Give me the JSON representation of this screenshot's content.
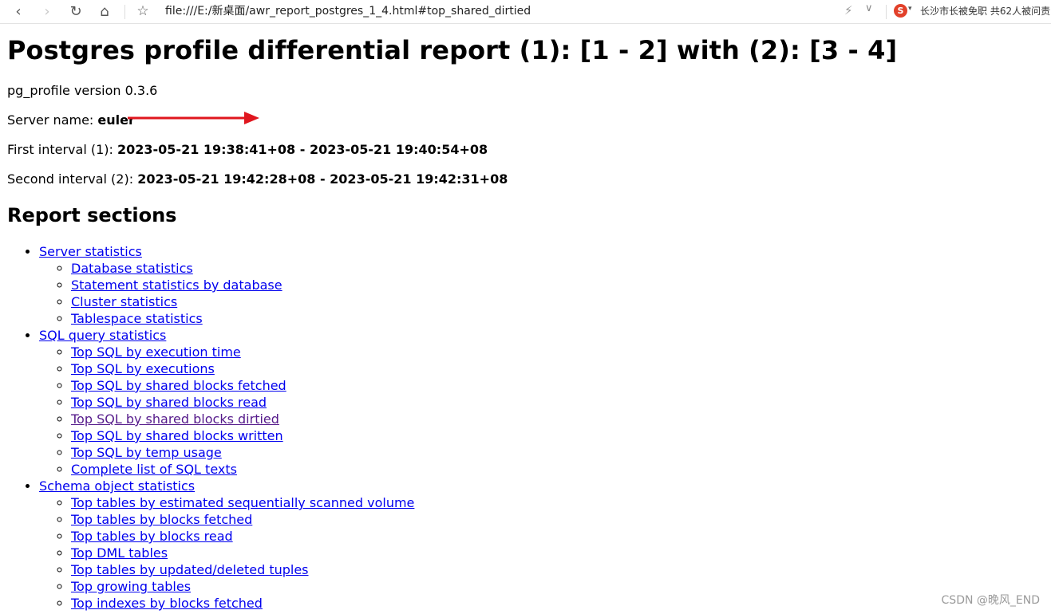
{
  "browser": {
    "address": "file:///E:/新桌面/awr_report_postgres_1_4.html#top_shared_dirtied",
    "news_ticker": "长沙市长被免职 共62人被问责",
    "sogou_label": "S"
  },
  "report": {
    "title": "Postgres profile differential report (1): [1 - 2] with (2): [3 - 4]",
    "version_line": "pg_profile version 0.3.6",
    "server_label": "Server name: ",
    "server_name": "euler",
    "first_label": "First interval (1): ",
    "first_interval": "2023-05-21 19:38:41+08 - 2023-05-21 19:40:54+08",
    "second_label": "Second interval (2): ",
    "second_interval": "2023-05-21 19:42:28+08 - 2023-05-21 19:42:31+08",
    "sections_heading": "Report sections",
    "sections": [
      {
        "label": "Server statistics",
        "items": [
          {
            "label": "Database statistics"
          },
          {
            "label": "Statement statistics by database"
          },
          {
            "label": "Cluster statistics"
          },
          {
            "label": "Tablespace statistics"
          }
        ]
      },
      {
        "label": "SQL query statistics",
        "items": [
          {
            "label": "Top SQL by execution time"
          },
          {
            "label": "Top SQL by executions"
          },
          {
            "label": "Top SQL by shared blocks fetched"
          },
          {
            "label": "Top SQL by shared blocks read"
          },
          {
            "label": "Top SQL by shared blocks dirtied",
            "visited": true
          },
          {
            "label": "Top SQL by shared blocks written"
          },
          {
            "label": "Top SQL by temp usage"
          },
          {
            "label": "Complete list of SQL texts"
          }
        ]
      },
      {
        "label": "Schema object statistics",
        "items": [
          {
            "label": "Top tables by estimated sequentially scanned volume"
          },
          {
            "label": "Top tables by blocks fetched"
          },
          {
            "label": "Top tables by blocks read"
          },
          {
            "label": "Top DML tables"
          },
          {
            "label": "Top tables by updated/deleted tuples"
          },
          {
            "label": "Top growing tables"
          },
          {
            "label": "Top indexes by blocks fetched"
          }
        ]
      }
    ]
  },
  "colors": {
    "link": "#0000ee",
    "visited": "#551a8b",
    "arrow": "#e0161e"
  },
  "watermark": "CSDN @晚风_END"
}
